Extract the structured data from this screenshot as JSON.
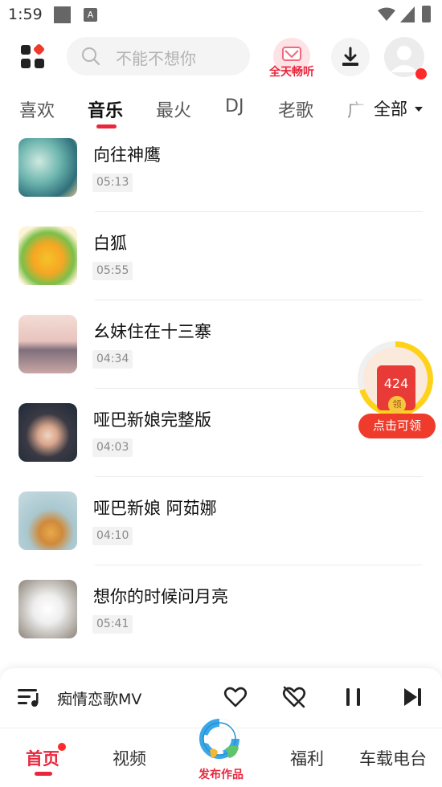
{
  "status_bar": {
    "time": "1:59",
    "a_icon_letter": "A"
  },
  "search": {
    "placeholder": "不能不想你"
  },
  "vip_badge": {
    "label": "全天畅听"
  },
  "tabs": {
    "items": [
      {
        "label": "喜欢"
      },
      {
        "label": "音乐"
      },
      {
        "label": "最火"
      },
      {
        "label": "DJ"
      },
      {
        "label": "老歌"
      },
      {
        "label": "广"
      }
    ],
    "active_index": 1,
    "all_label": "全部"
  },
  "songs": [
    {
      "title": "向往神鹰",
      "duration": "05:13"
    },
    {
      "title": "白狐",
      "duration": "05:55"
    },
    {
      "title": "幺妹住在十三寨",
      "duration": "04:34"
    },
    {
      "title": "哑巴新娘完整版",
      "duration": "04:03"
    },
    {
      "title": "哑巴新娘 阿茹娜",
      "duration": "04:10"
    },
    {
      "title": "想你的时候问月亮",
      "duration": "05:41"
    }
  ],
  "reward": {
    "amount": "424",
    "coin_label": "领",
    "button_label": "点击可领",
    "progress_fraction": 0.7
  },
  "player": {
    "now_playing": "痴情恋歌MV"
  },
  "bottom_nav": {
    "items": [
      "首页",
      "视频",
      "福利",
      "车载电台"
    ],
    "publish_label": "发布作品"
  },
  "colors": {
    "accent": "#e8273d",
    "reward_red": "#ef3b2c",
    "ring_yellow": "#ffd21a"
  },
  "icons": [
    "app-grid-icon",
    "search-icon",
    "download-icon",
    "avatar-icon",
    "heart-icon",
    "unlike-icon",
    "pause-icon",
    "next-icon",
    "playlist-icon"
  ]
}
